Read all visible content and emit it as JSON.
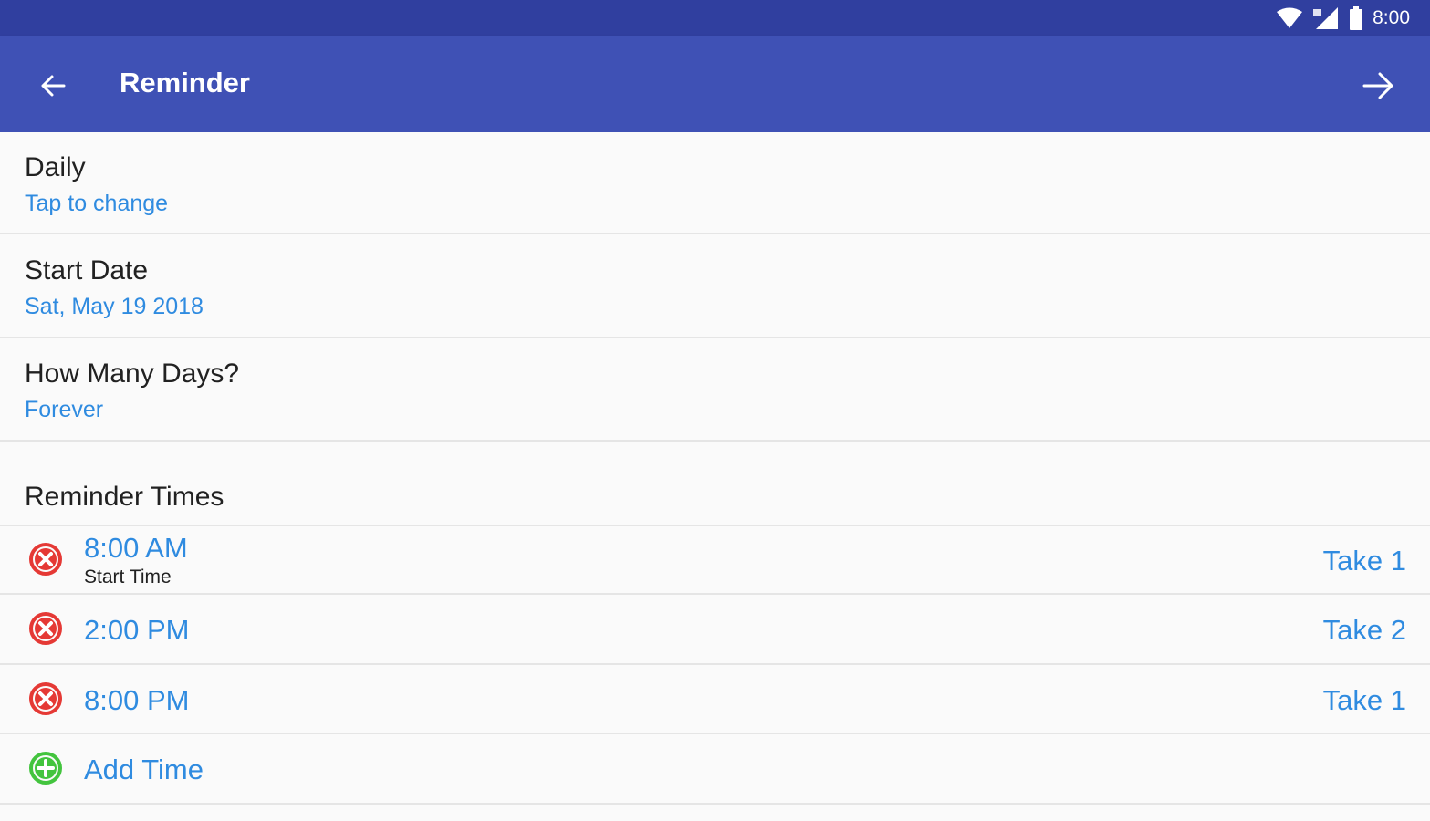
{
  "status_bar": {
    "time": "8:00",
    "icons": [
      "wifi-icon",
      "signal-icon",
      "battery-icon"
    ],
    "colors": {
      "background": "#303f9f"
    }
  },
  "app_bar": {
    "title": "Reminder",
    "back_icon": "arrow-left-icon",
    "next_icon": "arrow-right-icon",
    "colors": {
      "background": "#3f51b5"
    }
  },
  "settings": {
    "frequency": {
      "title": "Daily",
      "value": "Tap to change"
    },
    "start_date": {
      "title": "Start Date",
      "value": "Sat, May 19 2018"
    },
    "duration": {
      "title": "How Many Days?",
      "value": "Forever"
    }
  },
  "reminder_times": {
    "header": "Reminder Times",
    "items": [
      {
        "time": "8:00 AM",
        "subtitle": "Start Time",
        "take": "Take 1",
        "icon": "remove-circle-icon"
      },
      {
        "time": "2:00 PM",
        "subtitle": "",
        "take": "Take 2",
        "icon": "remove-circle-icon"
      },
      {
        "time": "8:00 PM",
        "subtitle": "",
        "take": "Take 1",
        "icon": "remove-circle-icon"
      }
    ],
    "add": {
      "label": "Add Time",
      "icon": "add-circle-icon"
    }
  },
  "colors": {
    "accent": "#2f8be0",
    "remove": "#e53935",
    "add": "#43c43e"
  }
}
